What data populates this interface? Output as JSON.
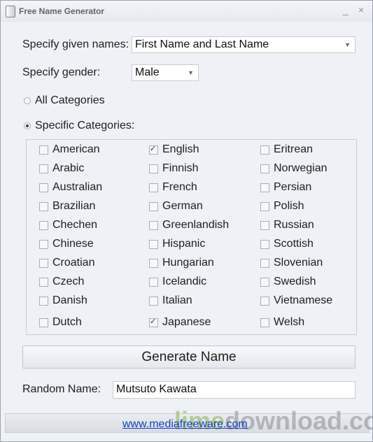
{
  "window": {
    "title": "Free Name Generator",
    "minimize": "_",
    "close": "×"
  },
  "given_names": {
    "label": "Specify given names:",
    "value": "First Name and Last Name"
  },
  "gender": {
    "label": "Specify gender:",
    "value": "Male"
  },
  "radios": {
    "all": {
      "label": "All Categories",
      "checked": false
    },
    "specific": {
      "label": "Specific Categories:",
      "checked": true
    }
  },
  "categories": {
    "col1": [
      {
        "label": "American",
        "checked": false
      },
      {
        "label": "Arabic",
        "checked": false
      },
      {
        "label": "Australian",
        "checked": false
      },
      {
        "label": "Brazilian",
        "checked": false
      },
      {
        "label": "Chechen",
        "checked": false
      },
      {
        "label": "Chinese",
        "checked": false
      },
      {
        "label": "Croatian",
        "checked": false
      },
      {
        "label": "Czech",
        "checked": false
      },
      {
        "label": "Danish",
        "checked": false
      },
      {
        "label": "Dutch",
        "checked": false
      }
    ],
    "col2": [
      {
        "label": "English",
        "checked": true
      },
      {
        "label": "Finnish",
        "checked": false
      },
      {
        "label": "French",
        "checked": false
      },
      {
        "label": "German",
        "checked": false
      },
      {
        "label": "Greenlandish",
        "checked": false
      },
      {
        "label": "Hispanic",
        "checked": false
      },
      {
        "label": "Hungarian",
        "checked": false
      },
      {
        "label": "Icelandic",
        "checked": false
      },
      {
        "label": "Italian",
        "checked": false
      },
      {
        "label": "Japanese",
        "checked": true
      }
    ],
    "col3": [
      {
        "label": "Eritrean",
        "checked": false
      },
      {
        "label": "Norwegian",
        "checked": false
      },
      {
        "label": "Persian",
        "checked": false
      },
      {
        "label": "Polish",
        "checked": false
      },
      {
        "label": "Russian",
        "checked": false
      },
      {
        "label": "Scottish",
        "checked": false
      },
      {
        "label": "Slovenian",
        "checked": false
      },
      {
        "label": "Swedish",
        "checked": false
      },
      {
        "label": "Vietnamese",
        "checked": false
      },
      {
        "label": "Welsh",
        "checked": false
      }
    ]
  },
  "generate_button": "Generate Name",
  "random_name": {
    "label": "Random Name:",
    "value": "Mutsuto Kawata"
  },
  "footer": {
    "link": "www.mediafreeware.com"
  },
  "watermark": {
    "part1": "lime",
    "part2": "download.com"
  }
}
